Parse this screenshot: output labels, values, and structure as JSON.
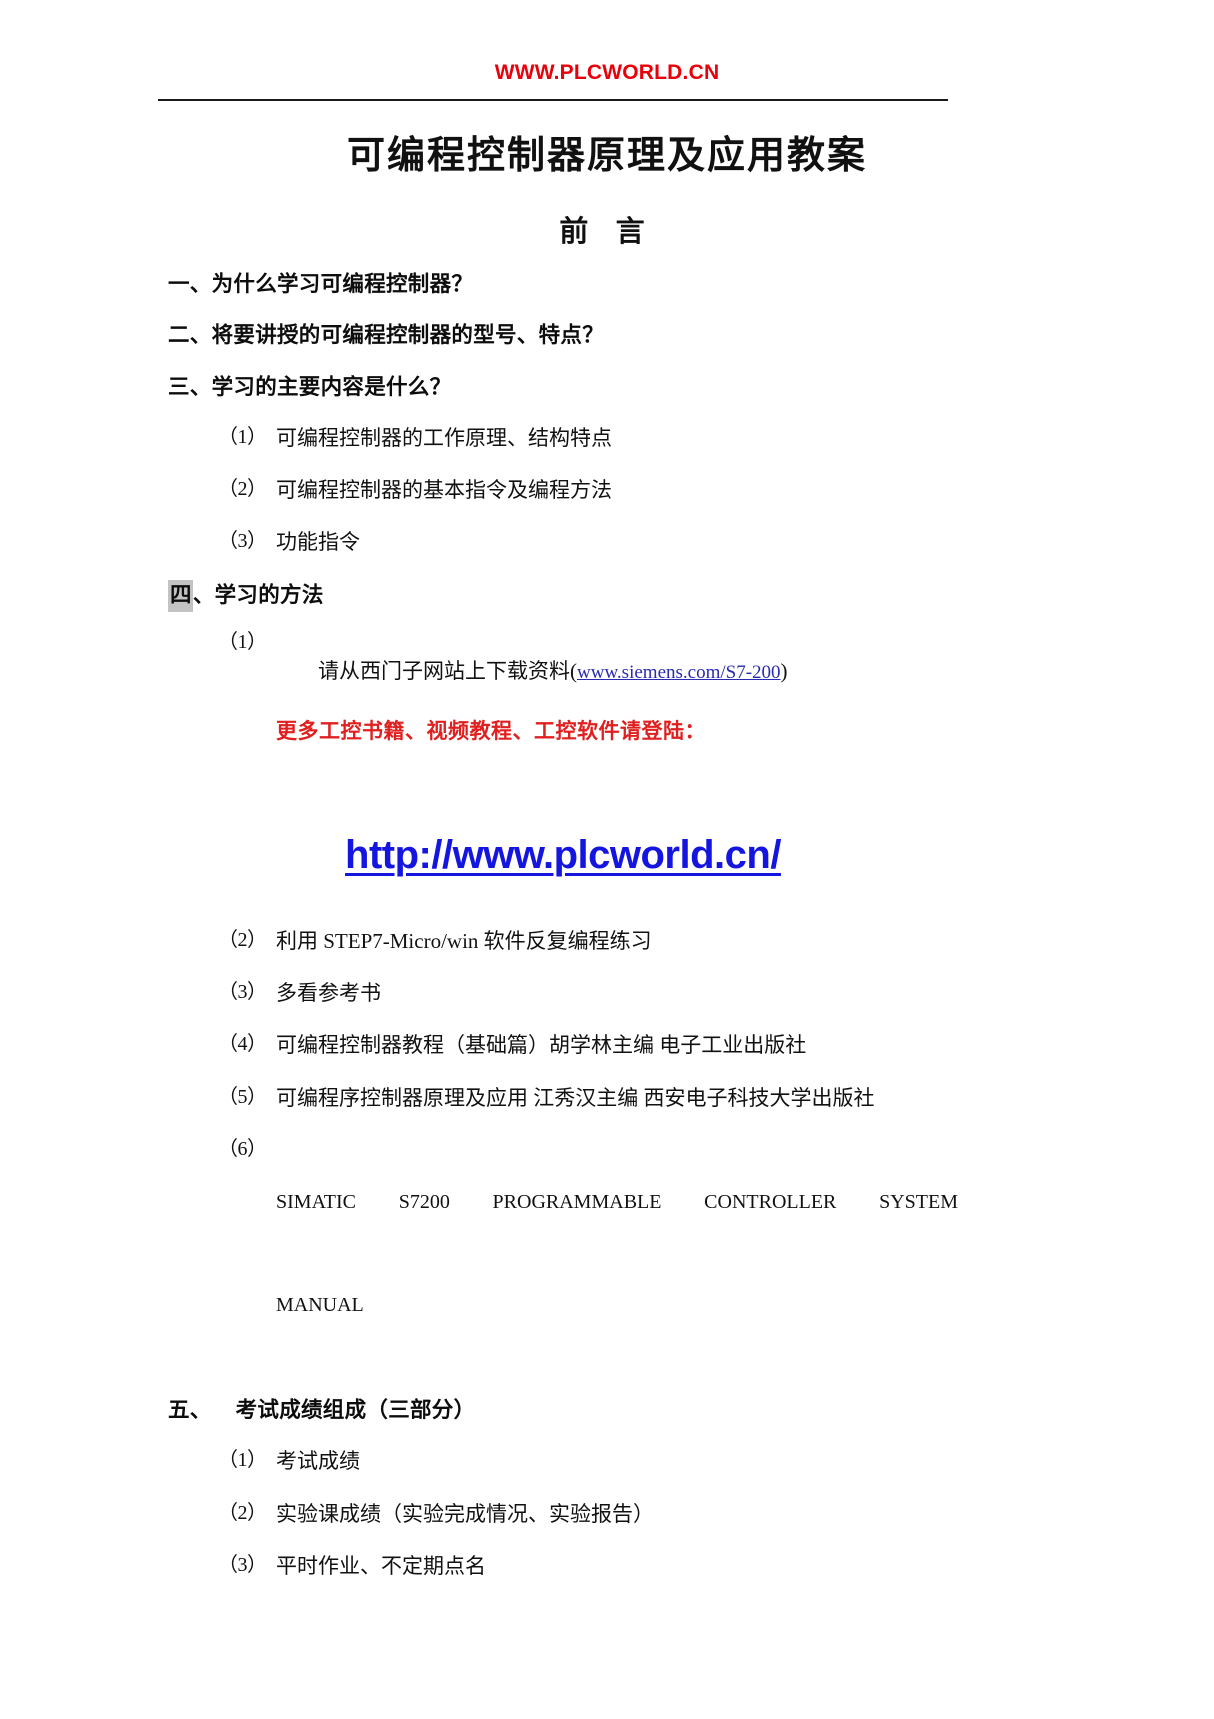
{
  "header": {
    "site_stamp": "WWW.PLCWORLD.CN"
  },
  "title": {
    "main": "可编程控制器原理及应用教案",
    "sub": "前 言"
  },
  "sections": [
    {
      "id": "s1",
      "heading": "一、为什么学习可编程控制器？"
    },
    {
      "id": "s2",
      "heading": "二、将要讲授的可编程控制器的型号、特点？"
    },
    {
      "id": "s3",
      "heading": "三、学习的主要内容是什么？",
      "items": [
        {
          "marker": "（1）",
          "text": "可编程控制器的工作原理、结构特点"
        },
        {
          "marker": "（2）",
          "text": "可编程控制器的基本指令及编程方法"
        },
        {
          "marker": "（3）",
          "text": "功能指令"
        }
      ]
    },
    {
      "id": "s4",
      "heading_shaded_char": "四",
      "heading_rest": "、学习的方法",
      "items": [
        {
          "marker": "（1）",
          "text_before": "请从西门子网站上下载资料(",
          "link_text": "www.siemens.com/S7-200",
          "text_after": ")",
          "red_note": "更多工控书籍、视频教程、工控软件请登陆："
        },
        {
          "marker": "（2）",
          "text": "利用 STEP7-Micro/win 软件反复编程练习"
        },
        {
          "marker": "（3）",
          "text": "多看参考书"
        },
        {
          "marker": "（4）",
          "text": "可编程控制器教程（基础篇）胡学林主编 电子工业出版社"
        },
        {
          "marker": "（5）",
          "text": "可编程序控制器原理及应用 江秀汉主编 西安电子科技大学出版社"
        },
        {
          "marker": "（6）",
          "text_line1": "SIMATIC S7200 PROGRAMMABLE CONTROLLER SYSTEM",
          "text_line2": "MANUAL"
        }
      ]
    },
    {
      "id": "s5",
      "heading_num": "五、",
      "heading_text": "考试成绩组成（三部分）",
      "items": [
        {
          "marker": "（1）",
          "text": "考试成绩"
        },
        {
          "marker": "（2）",
          "text": "实验课成绩（实验完成情况、实验报告）"
        },
        {
          "marker": "（3）",
          "text": "平时作业、不定期点名"
        }
      ]
    }
  ],
  "big_url": "http://www.plcworld.cn/",
  "colors": {
    "stamp_red": "#e8000a",
    "note_red": "#e02020",
    "link_blue": "#2a2ab0",
    "big_url_blue": "#1515e0",
    "highlight_gray": "#c3c3c3"
  }
}
